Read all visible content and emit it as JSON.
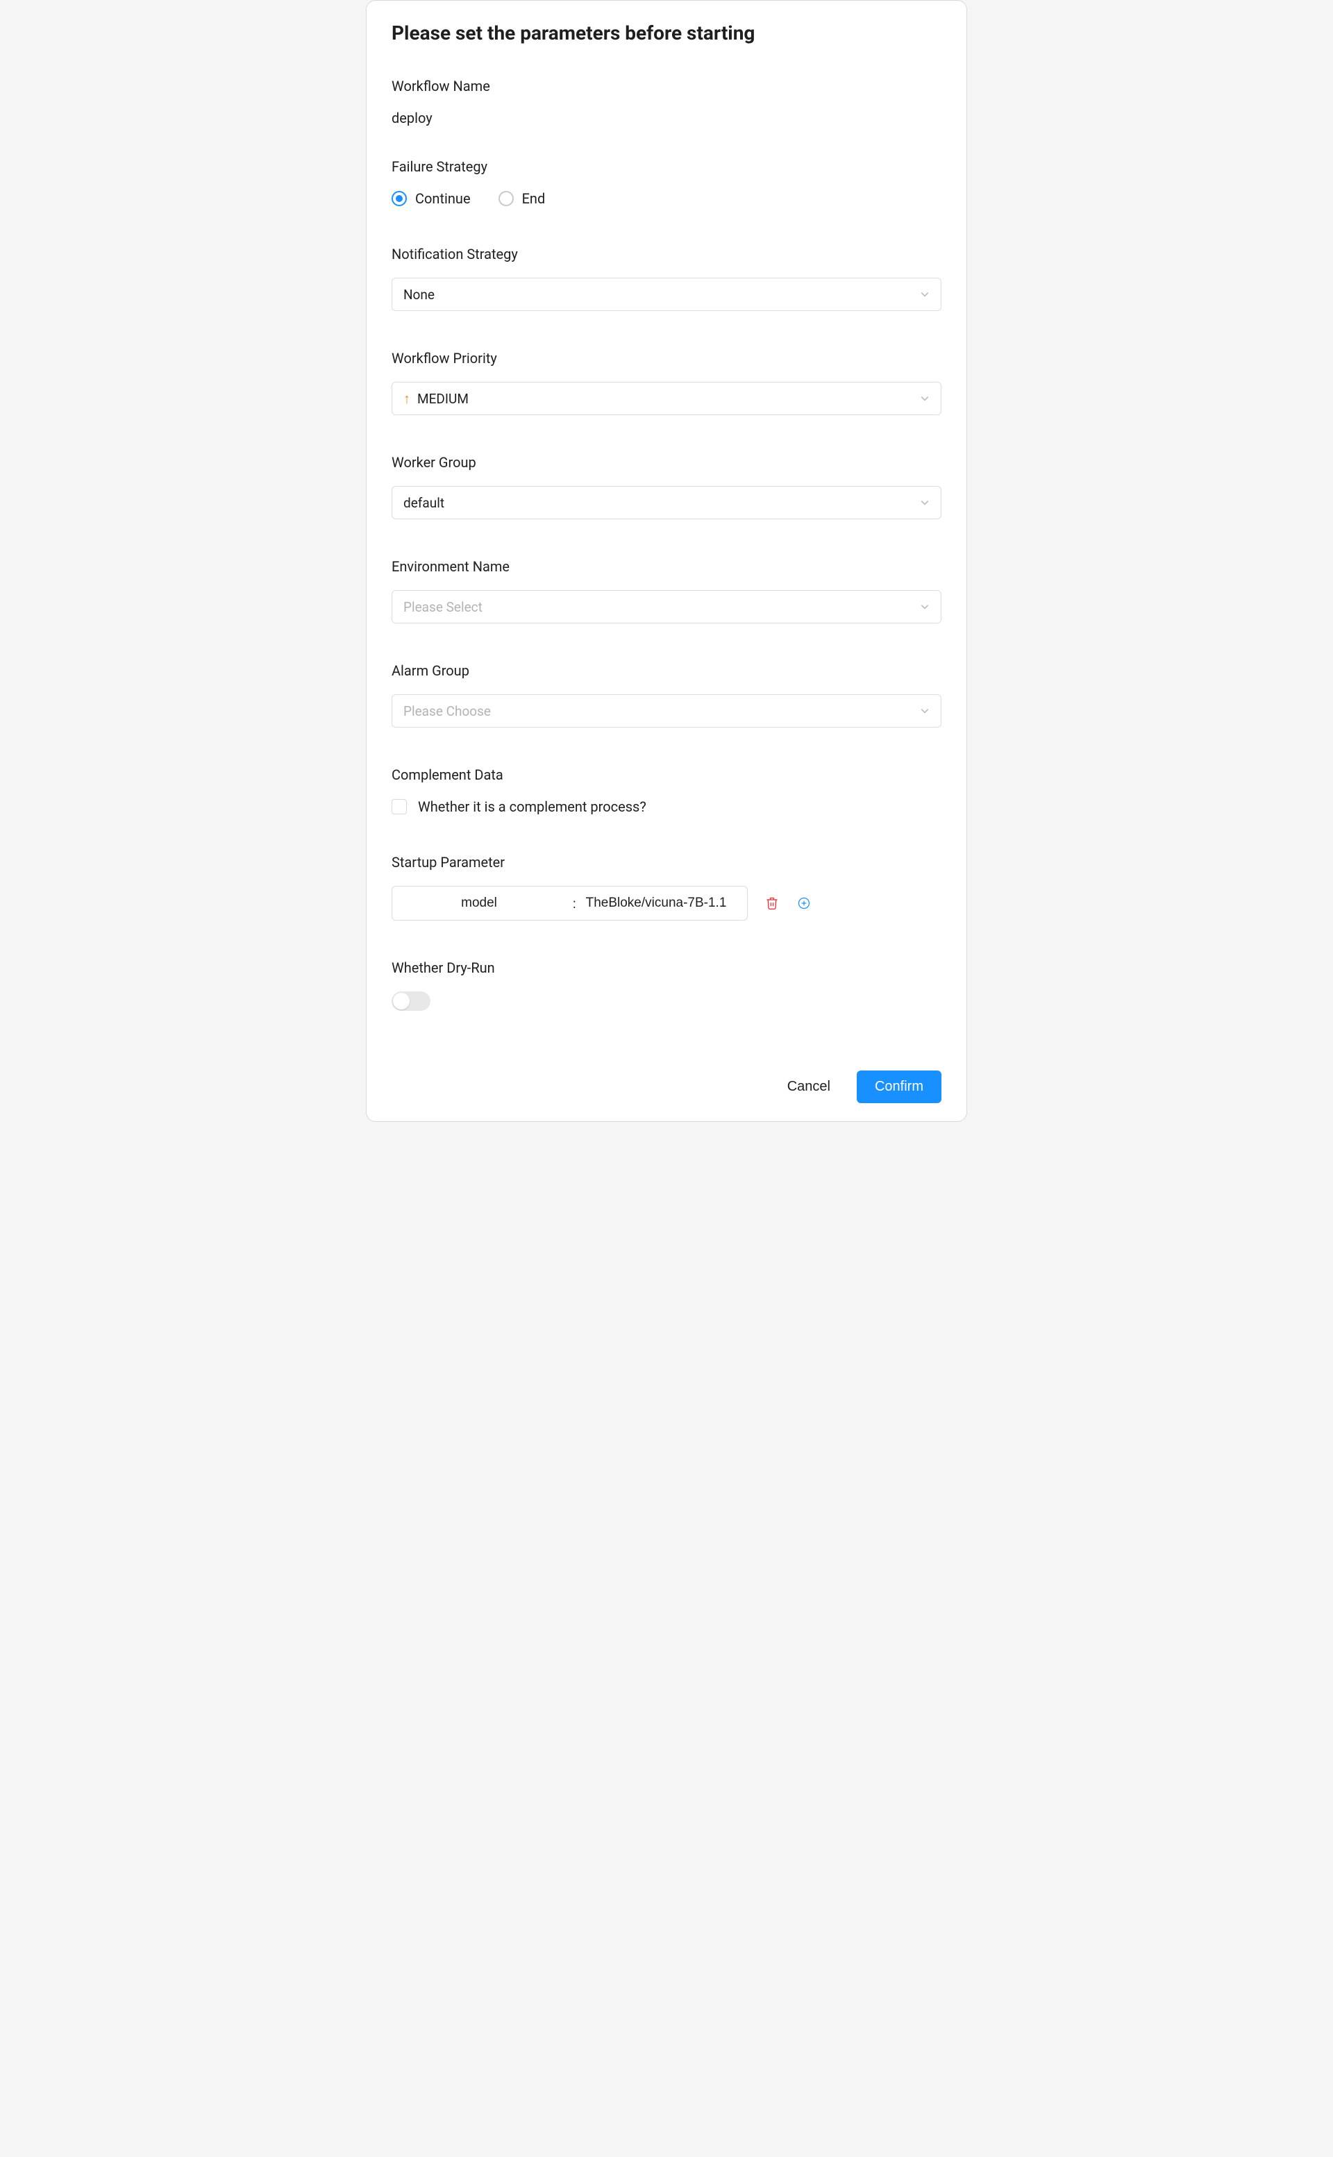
{
  "title": "Please set the parameters before starting",
  "workflow_name": {
    "label": "Workflow Name",
    "value": "deploy"
  },
  "failure_strategy": {
    "label": "Failure Strategy",
    "options": {
      "continue": "Continue",
      "end": "End"
    },
    "selected": "continue"
  },
  "notification_strategy": {
    "label": "Notification Strategy",
    "value": "None"
  },
  "workflow_priority": {
    "label": "Workflow Priority",
    "value": "MEDIUM"
  },
  "worker_group": {
    "label": "Worker Group",
    "value": "default"
  },
  "environment_name": {
    "label": "Environment Name",
    "placeholder": "Please Select"
  },
  "alarm_group": {
    "label": "Alarm Group",
    "placeholder": "Please Choose"
  },
  "complement_data": {
    "label": "Complement Data",
    "checkbox_label": "Whether it is a complement process?",
    "checked": false
  },
  "startup_parameter": {
    "label": "Startup Parameter",
    "rows": [
      {
        "key": "model",
        "value": "TheBloke/vicuna-7B-1.1"
      }
    ],
    "separator": ":"
  },
  "dry_run": {
    "label": "Whether Dry-Run",
    "enabled": false
  },
  "footer": {
    "cancel": "Cancel",
    "confirm": "Confirm"
  }
}
